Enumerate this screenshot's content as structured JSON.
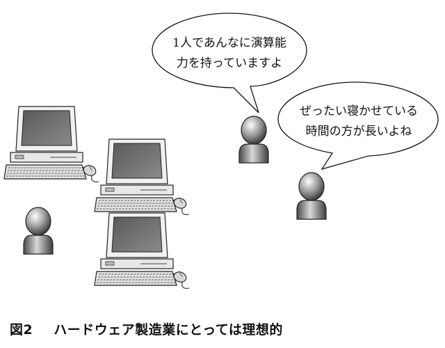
{
  "caption": {
    "figure_number": "図2",
    "text": "ハードウェア製造業にとっては理想的"
  },
  "bubbles": [
    {
      "lines": [
        "1人であんなに演算能",
        "力を持っていますよ"
      ]
    },
    {
      "lines": [
        "ぜったい寝かせている",
        "時間の方が長いよね"
      ]
    }
  ],
  "icons": {
    "person": "person-icon",
    "computer": "desktop-computer-icon",
    "mouse": "mouse-icon"
  }
}
